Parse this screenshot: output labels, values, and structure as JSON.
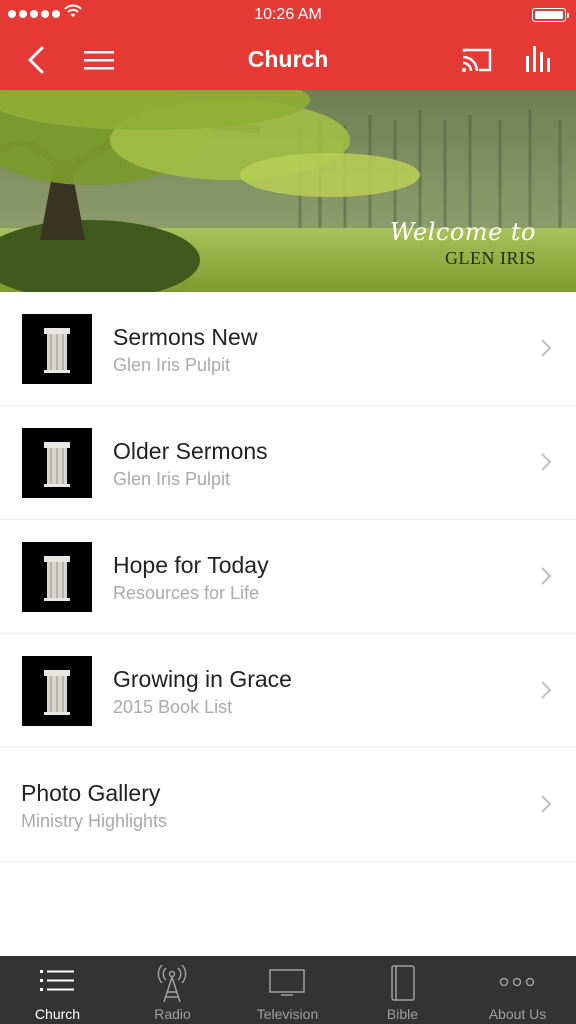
{
  "status_bar": {
    "time": "10:26 AM"
  },
  "nav": {
    "title": "Church",
    "back_icon": "back-chevron-icon",
    "menu_icon": "hamburger-menu-icon",
    "cast_icon": "cast-icon",
    "equalizer_icon": "equalizer-icon"
  },
  "hero": {
    "welcome_line1": "Welcome to",
    "welcome_line2": "GLEN IRIS"
  },
  "list": [
    {
      "title": "Sermons New",
      "subtitle": "Glen Iris Pulpit"
    },
    {
      "title": "Older Sermons",
      "subtitle": "Glen Iris Pulpit"
    },
    {
      "title": "Hope for Today",
      "subtitle": "Resources for Life"
    },
    {
      "title": "Growing in Grace",
      "subtitle": "2015 Book List"
    },
    {
      "title": "Photo Gallery",
      "subtitle": "Ministry Highlights"
    }
  ],
  "tabs": [
    {
      "label": "Church",
      "icon": "list-icon",
      "active": true
    },
    {
      "label": "Radio",
      "icon": "radio-tower-icon"
    },
    {
      "label": "Television",
      "icon": "television-icon"
    },
    {
      "label": "Bible",
      "icon": "book-icon"
    },
    {
      "label": "About Us",
      "icon": "more-dots-icon"
    }
  ],
  "colors": {
    "header": "#e53935",
    "tabbar": "#333333",
    "active_tab": "#ffffff",
    "inactive_tab": "#a0a0a0"
  }
}
